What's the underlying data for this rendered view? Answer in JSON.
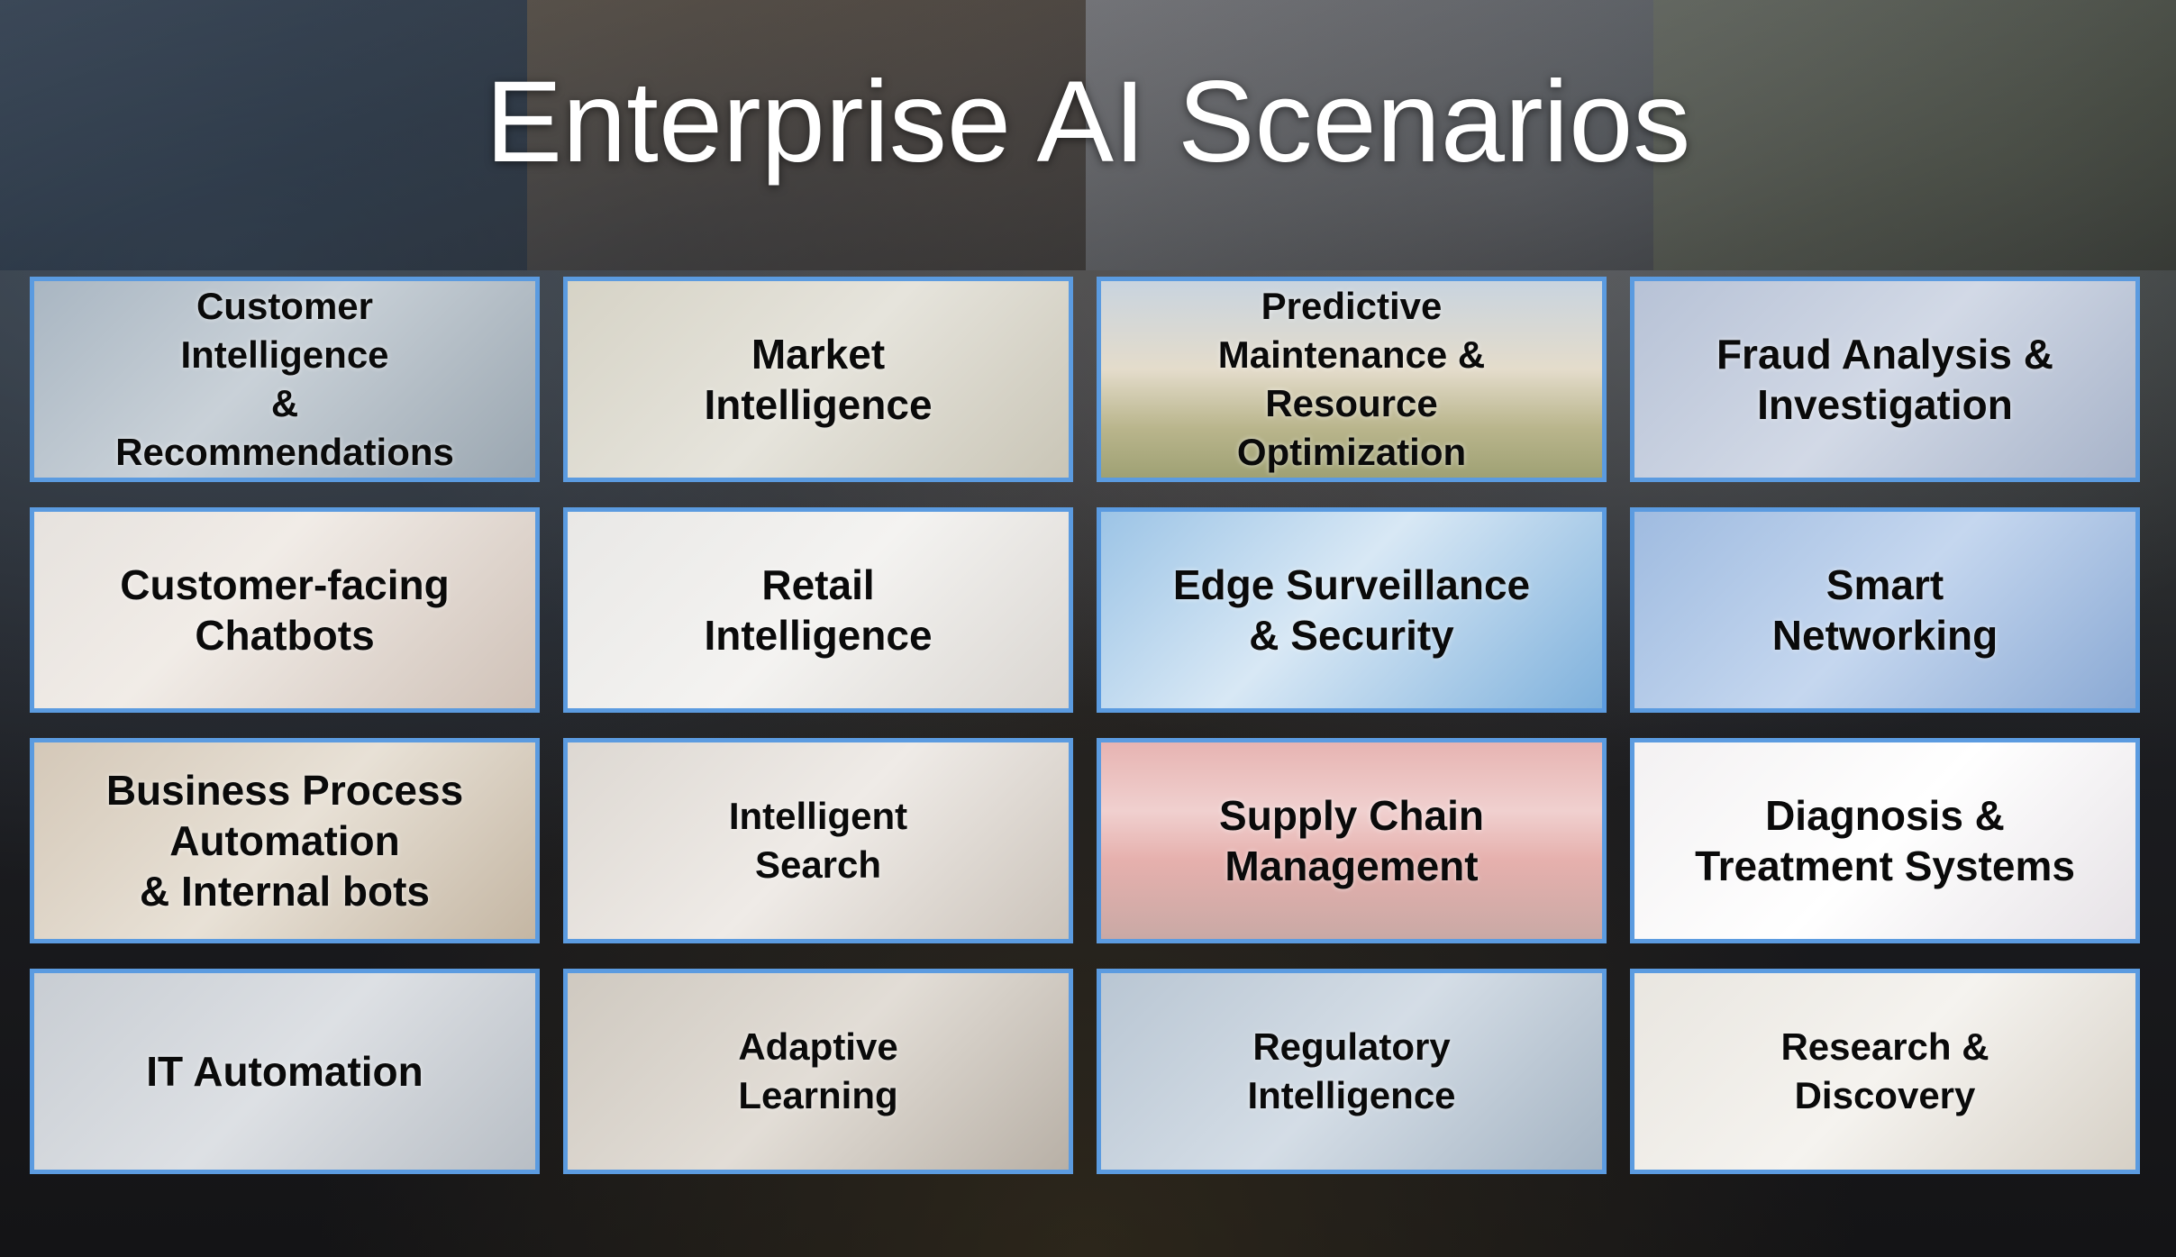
{
  "slide": {
    "title": "Enterprise AI Scenarios",
    "accent_color": "#5b9be0",
    "tiles": [
      {
        "label": "Customer\nIntelligence\n&\nRecommendations"
      },
      {
        "label": "Market\nIntelligence"
      },
      {
        "label": "Predictive\nMaintenance &\nResource\nOptimization"
      },
      {
        "label": "Fraud Analysis &\nInvestigation"
      },
      {
        "label": "Customer-facing\nChatbots"
      },
      {
        "label": "Retail\nIntelligence"
      },
      {
        "label": "Edge Surveillance\n& Security"
      },
      {
        "label": "Smart\nNetworking"
      },
      {
        "label": "Business Process\nAutomation\n& Internal bots"
      },
      {
        "label": "Intelligent\nSearch"
      },
      {
        "label": "Supply Chain\nManagement"
      },
      {
        "label": "Diagnosis &\nTreatment Systems"
      },
      {
        "label": "IT Automation"
      },
      {
        "label": "Adaptive\nLearning"
      },
      {
        "label": "Regulatory\nIntelligence"
      },
      {
        "label": "Research &\nDiscovery"
      }
    ]
  }
}
